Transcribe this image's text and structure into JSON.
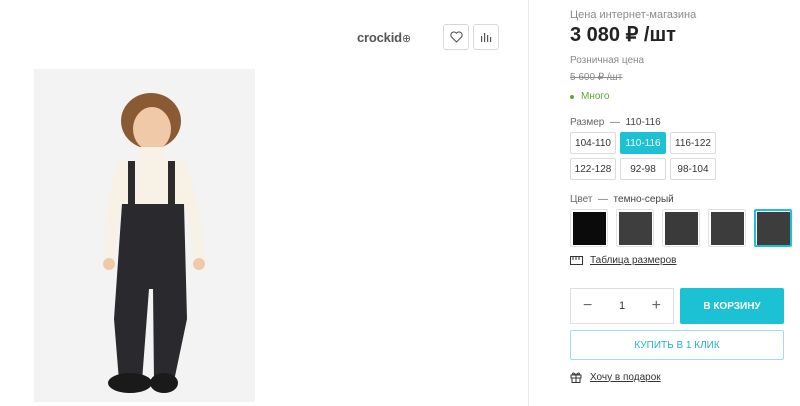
{
  "brand": "crockid",
  "icons": {
    "favorite": "heart-icon",
    "compare": "bar-chart-icon",
    "size_table": "ruler-icon",
    "gift": "gift-icon"
  },
  "price": {
    "online_label": "Цена интернет-магазина",
    "online_value": "3 080 ₽ /шт",
    "retail_label": "Розничная цена",
    "retail_value": "5 600 ₽ /шт"
  },
  "stock": "Много",
  "size": {
    "label": "Размер",
    "separator": "—",
    "selected": "110-116",
    "options": [
      "104-110",
      "110-116",
      "116-122",
      "122-128",
      "92-98",
      "98-104"
    ]
  },
  "color": {
    "label": "Цвет",
    "separator": "—",
    "selected": "темно-серый",
    "swatches": [
      "#0b0b0b",
      "#3e3e3e",
      "#3a3a3a",
      "#3c3c3c",
      "#3d3d3d"
    ],
    "accent": "#1dc1d4"
  },
  "size_table_link": "Таблица размеров",
  "quantity": {
    "minus": "−",
    "value": "1",
    "plus": "+"
  },
  "buttons": {
    "cart": "В КОРЗИНУ",
    "one_click": "КУПИТЬ В 1 КЛИК"
  },
  "gift_link": "Хочу в подарок"
}
